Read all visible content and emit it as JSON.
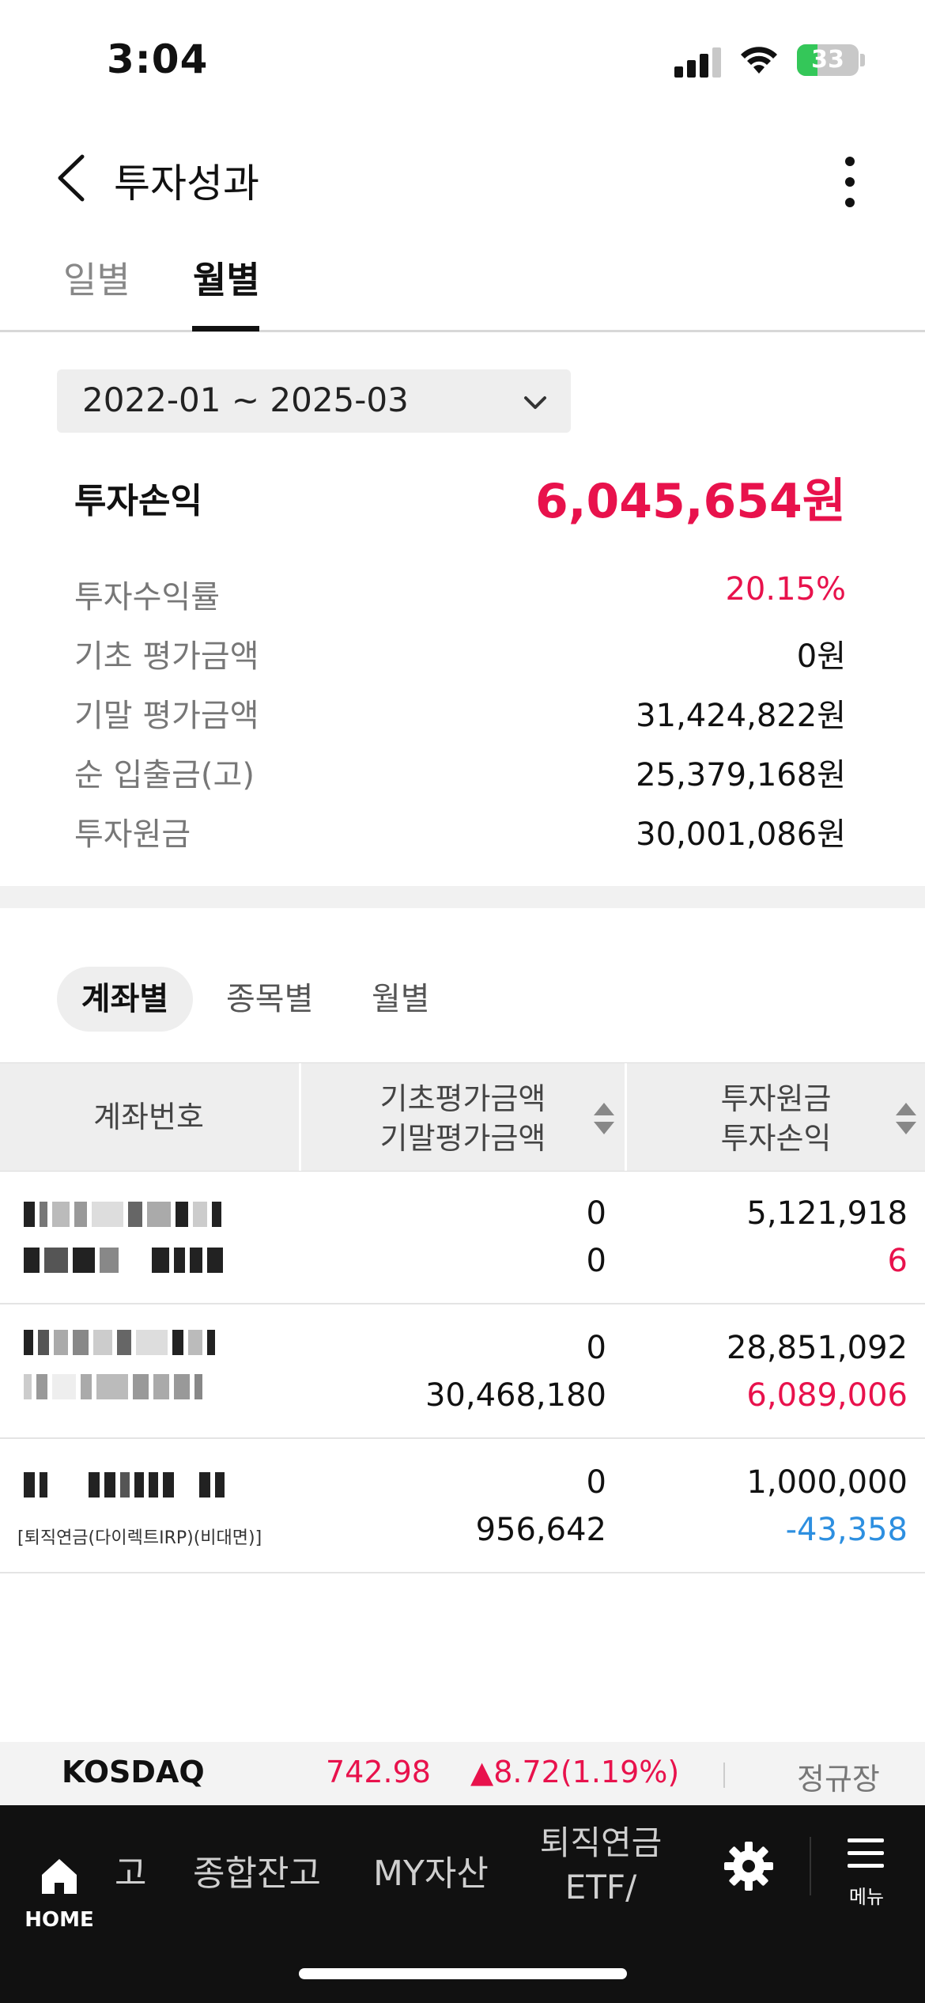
{
  "status_bar": {
    "time": "3:04",
    "battery": "33",
    "battery_level": 0.33
  },
  "header": {
    "title": "투자성과",
    "back_icon": "chevron-left-icon",
    "more_icon": "more-vertical-icon"
  },
  "tabs": [
    {
      "label": "일별",
      "active": false
    },
    {
      "label": "월별",
      "active": true
    }
  ],
  "period": {
    "value": "2022-01 ~ 2025-03"
  },
  "summary": {
    "main_label": "투자손익",
    "main_value": "6,045,654원",
    "rows": [
      {
        "label": "투자수익률",
        "value": "20.15%"
      },
      {
        "label": "기초 평가금액",
        "value": "0원"
      },
      {
        "label": "기말 평가금액",
        "value": "31,424,822원"
      },
      {
        "label": "순 입출금(고)",
        "value": "25,379,168원"
      },
      {
        "label": "투자원금",
        "value": "30,001,086원"
      }
    ]
  },
  "segments": [
    {
      "label": "계좌별",
      "active": true
    },
    {
      "label": "종목별",
      "active": false
    },
    {
      "label": "월별",
      "active": false
    }
  ],
  "table": {
    "headers": {
      "account": "계좌번호",
      "base_line1": "기초평가금액",
      "base_line2": "기말평가금액",
      "principal_line1": "투자원금",
      "principal_line2": "투자손익"
    },
    "rows": [
      {
        "account_sub": "",
        "base_start": "0",
        "base_end": "0",
        "principal": "5,121,918",
        "pnl": "6"
      },
      {
        "account_sub": "",
        "base_start": "0",
        "base_end": "30,468,180",
        "principal": "28,851,092",
        "pnl": "6,089,006"
      },
      {
        "account_sub": "[퇴직연금(다이렉트IRP)(비대면)]",
        "base_start": "0",
        "base_end": "956,642",
        "principal": "1,000,000",
        "pnl": "-43,358"
      }
    ]
  },
  "ticker": {
    "name": "KOSDAQ",
    "price": "742.98",
    "change": "▲8.72(1.19%)",
    "market_status": "정규장"
  },
  "bottom_nav": {
    "home_label": "HOME",
    "partial_label": "고",
    "summary_label": "종합잔고",
    "my_label": "MY자산",
    "pension_line1": "퇴직연금",
    "pension_line2": "ETF/",
    "menu_label": "메뉴",
    "gear_icon": "gear-icon"
  },
  "colors": {
    "red": "#e8124c",
    "blue": "#2d8fe0",
    "nav_bg": "#111111"
  }
}
